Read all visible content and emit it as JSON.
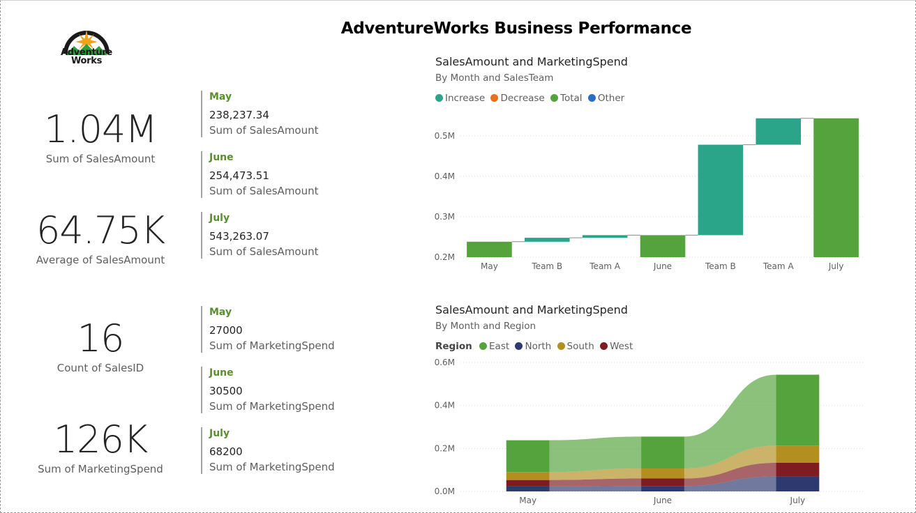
{
  "report": {
    "title": "AdventureWorks Business Performance"
  },
  "logo": {
    "line1": "Adventure",
    "line2": "Works",
    "colors": {
      "arc": "#1a1a1a",
      "sun": "#f0a21d",
      "mountain": "#2e9e3b"
    }
  },
  "kpis": [
    {
      "value": "1.04M",
      "label": "Sum of SalesAmount"
    },
    {
      "value": "64.75K",
      "label": "Average of SalesAmount"
    },
    {
      "value": "16",
      "label": "Count of SalesID"
    },
    {
      "value": "126K",
      "label": "Sum of MarketingSpend"
    }
  ],
  "sales_cards": [
    {
      "month": "May",
      "value": "238,237.34",
      "label": "Sum of SalesAmount"
    },
    {
      "month": "June",
      "value": "254,473.51",
      "label": "Sum of SalesAmount"
    },
    {
      "month": "July",
      "value": "543,263.07",
      "label": "Sum of SalesAmount"
    }
  ],
  "marketing_cards": [
    {
      "month": "May",
      "value": "27000",
      "label": "Sum of MarketingSpend"
    },
    {
      "month": "June",
      "value": "30500",
      "label": "Sum of MarketingSpend"
    },
    {
      "month": "July",
      "value": "68200",
      "label": "Sum of MarketingSpend"
    }
  ],
  "chart_data": [
    {
      "type": "waterfall",
      "title": "SalesAmount and MarketingSpend",
      "subtitle": "By Month and SalesTeam",
      "legend": [
        {
          "name": "Increase",
          "color": "#2aa58a"
        },
        {
          "name": "Decrease",
          "color": "#e8701a"
        },
        {
          "name": "Total",
          "color": "#55a33c"
        },
        {
          "name": "Other",
          "color": "#2b6cc4"
        }
      ],
      "categories": [
        "May",
        "Team B",
        "Team A",
        "June",
        "Team B",
        "Team A",
        "July"
      ],
      "bars": [
        {
          "kind": "Total",
          "start": 0,
          "end": 238237
        },
        {
          "kind": "Increase",
          "start": 238237,
          "end": 248000
        },
        {
          "kind": "Increase",
          "start": 248000,
          "end": 254474
        },
        {
          "kind": "Total",
          "start": 0,
          "end": 254474
        },
        {
          "kind": "Increase",
          "start": 254474,
          "end": 478000
        },
        {
          "kind": "Increase",
          "start": 478000,
          "end": 543263
        },
        {
          "kind": "Total",
          "start": 0,
          "end": 543263
        }
      ],
      "yticks": [
        {
          "v": 200000,
          "label": "0.2M"
        },
        {
          "v": 300000,
          "label": "0.3M"
        },
        {
          "v": 400000,
          "label": "0.4M"
        },
        {
          "v": 500000,
          "label": "0.5M"
        }
      ],
      "ylim": [
        200000,
        560000
      ]
    },
    {
      "type": "ribbon",
      "title": "SalesAmount and MarketingSpend",
      "subtitle": "By Month and Region",
      "legend_title": "Region",
      "categories": [
        "May",
        "June",
        "July"
      ],
      "series": [
        {
          "name": "East",
          "color": "#55a33c",
          "values": [
            148000,
            148000,
            330000
          ]
        },
        {
          "name": "North",
          "color": "#2d3a70",
          "values": [
            23000,
            25000,
            70000
          ]
        },
        {
          "name": "South",
          "color": "#b38f22",
          "values": [
            37000,
            47000,
            80000
          ]
        },
        {
          "name": "West",
          "color": "#7e1c22",
          "values": [
            30000,
            35000,
            63000
          ]
        }
      ],
      "stack_order": [
        "North",
        "West",
        "South",
        "East"
      ],
      "yticks": [
        {
          "v": 0,
          "label": "0.0M"
        },
        {
          "v": 200000,
          "label": "0.2M"
        },
        {
          "v": 400000,
          "label": "0.4M"
        },
        {
          "v": 600000,
          "label": "0.6M"
        }
      ],
      "ylim": [
        0,
        600000
      ]
    }
  ]
}
